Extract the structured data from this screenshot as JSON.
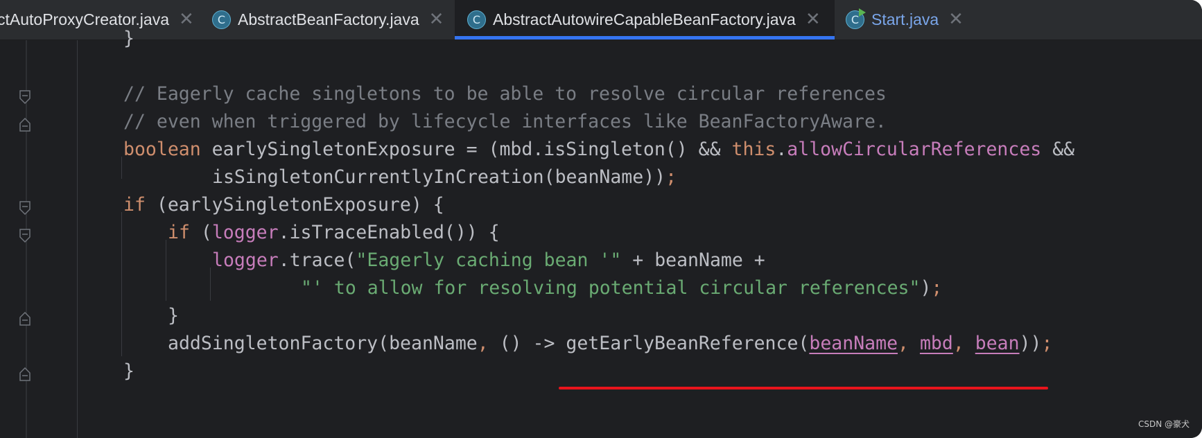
{
  "tabs": [
    {
      "label": "ctAutoProxyCreator.java",
      "active": false,
      "icon": "none"
    },
    {
      "label": "AbstractBeanFactory.java",
      "active": false,
      "icon": "class-icon"
    },
    {
      "label": "AbstractAutowireCapableBeanFactory.java",
      "active": true,
      "icon": "class-icon"
    },
    {
      "label": "Start.java",
      "active": false,
      "icon": "run-class-icon"
    }
  ],
  "class_icon_glyph": "C",
  "close_glyph": "✕",
  "editor": {
    "lines": {
      "l1": "}",
      "l3": "// Eagerly cache singletons to be able to resolve circular references",
      "l4": "// even when triggered by lifecycle interfaces like BeanFactoryAware.",
      "l5_kw": "boolean",
      "l5_a": " earlySingletonExposure = (mbd.isSingleton() && ",
      "l5_this": "this",
      "l5_dot": ".",
      "l5_field": "allowCircularReferences",
      "l5_end": " &&",
      "l6_a": "isSingletonCurrentlyInCreation(beanName))",
      "l6_semi": ";",
      "l7_kw": "if",
      "l7_a": " (earlySingletonExposure) {",
      "l8_kw": "if",
      "l8_b": " (",
      "l8_field": "logger",
      "l8_c": ".isTraceEnabled()) {",
      "l9_field": "logger",
      "l9_a": ".trace(",
      "l9_str": "\"Eagerly caching bean '\"",
      "l9_b": " + beanName +",
      "l10_str": "\"' to allow for resolving potential circular references\"",
      "l10_b": ")",
      "l10_semi": ";",
      "l11": "}",
      "l12_a": "addSingletonFactory(beanName",
      "l12_comma": ",",
      "l12_b": " () -> getEarlyBeanReference(",
      "l12_p1": "beanName",
      "l12_c1": ", ",
      "l12_p2": "mbd",
      "l12_c2": ", ",
      "l12_p3": "bean",
      "l12_d": "))",
      "l12_semi": ";",
      "l13": "}"
    }
  },
  "watermark": "CSDN @豪犬",
  "colors": {
    "background": "#1e1f22",
    "keyword": "#cf8e6d",
    "field": "#c77dbb",
    "string": "#6aab73",
    "comment": "#7a7e85",
    "text": "#bcbec4",
    "tab_active_underline": "#3574f0",
    "annotation_underline": "#e8141c"
  }
}
